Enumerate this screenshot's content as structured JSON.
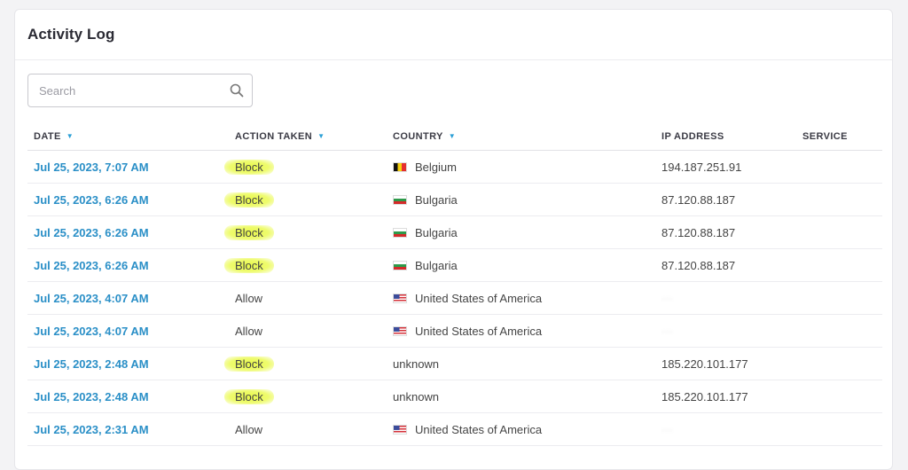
{
  "header": {
    "title": "Activity Log"
  },
  "search": {
    "placeholder": "Search",
    "value": ""
  },
  "table": {
    "columns": [
      "DATE",
      "ACTION TAKEN",
      "COUNTRY",
      "IP ADDRESS",
      "SERVICE"
    ],
    "rows": [
      {
        "date": "Jul 25, 2023, 7:07 AM",
        "action": "Block",
        "country": "Belgium",
        "flag": "flag-be",
        "ip": "194.187.251.91",
        "service": ""
      },
      {
        "date": "Jul 25, 2023, 6:26 AM",
        "action": "Block",
        "country": "Bulgaria",
        "flag": "flag-bg",
        "ip": "87.120.88.187",
        "service": ""
      },
      {
        "date": "Jul 25, 2023, 6:26 AM",
        "action": "Block",
        "country": "Bulgaria",
        "flag": "flag-bg",
        "ip": "87.120.88.187",
        "service": ""
      },
      {
        "date": "Jul 25, 2023, 6:26 AM",
        "action": "Block",
        "country": "Bulgaria",
        "flag": "flag-bg",
        "ip": "87.120.88.187",
        "service": ""
      },
      {
        "date": "Jul 25, 2023, 4:07 AM",
        "action": "Allow",
        "country": "United States of America",
        "flag": "flag-us",
        "ip": "",
        "service": ""
      },
      {
        "date": "Jul 25, 2023, 4:07 AM",
        "action": "Allow",
        "country": "United States of America",
        "flag": "flag-us",
        "ip": "",
        "service": ""
      },
      {
        "date": "Jul 25, 2023, 2:48 AM",
        "action": "Block",
        "country": "unknown",
        "flag": "",
        "ip": "185.220.101.177",
        "service": ""
      },
      {
        "date": "Jul 25, 2023, 2:48 AM",
        "action": "Block",
        "country": "unknown",
        "flag": "",
        "ip": "185.220.101.177",
        "service": ""
      },
      {
        "date": "Jul 25, 2023, 2:31 AM",
        "action": "Allow",
        "country": "United States of America",
        "flag": "flag-us",
        "ip": "",
        "service": ""
      }
    ]
  },
  "colors": {
    "accent": "#2a8fc7",
    "highlight": "#eefb6e"
  }
}
